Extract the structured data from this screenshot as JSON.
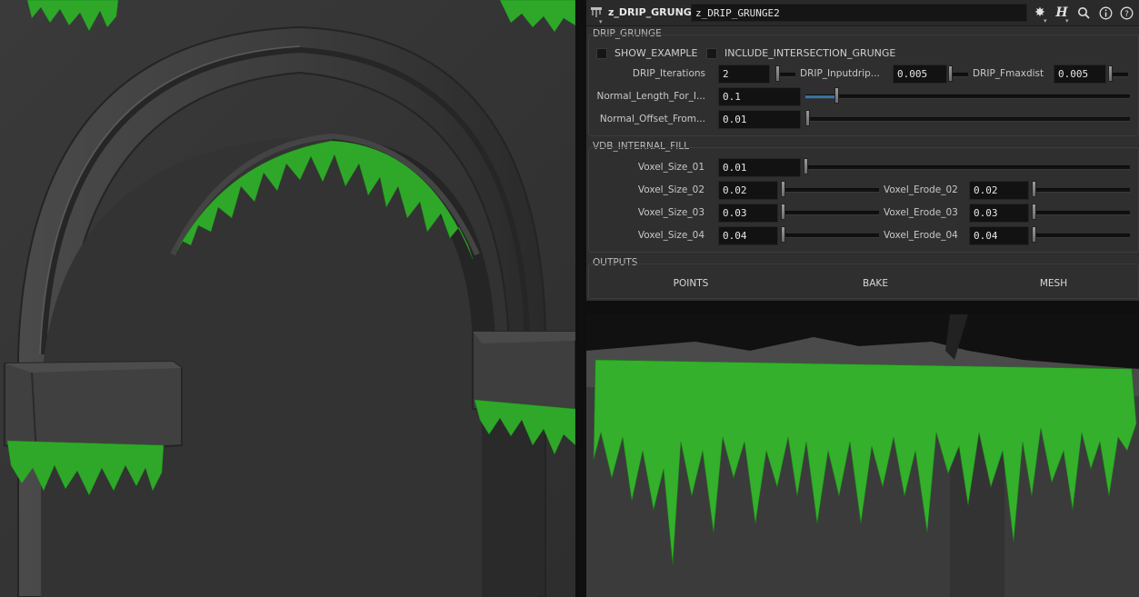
{
  "header": {
    "node_type": "z_DRIP_GRUNGE",
    "node_name": "z_DRIP_GRUNGE2",
    "icons": [
      "gear-icon",
      "houdini-help-icon",
      "search-icon",
      "info-icon",
      "help-icon"
    ]
  },
  "drip_grunge": {
    "folder_label": "DRIP_GRUNGE",
    "show_example_label": "SHOW_EXAMPLE",
    "include_intersection_label": "INCLUDE_INTERSECTION_GRUNGE",
    "drip_iterations_label": "DRIP_Iterations",
    "drip_iterations_value": "2",
    "drip_inputdrip_label": "DRIP_Inputdrip...",
    "drip_inputdrip_value": "0.005",
    "drip_fmaxdist_label": "DRIP_Fmaxdist",
    "drip_fmaxdist_value": "0.005",
    "normal_length_label": "Normal_Length_For_I...",
    "normal_length_value": "0.1",
    "normal_offset_label": "Normal_Offset_From...",
    "normal_offset_value": "0.01"
  },
  "vdb_internal_fill": {
    "folder_label": "VDB_INTERNAL_FILL",
    "voxel_size_01_label": "Voxel_Size_01",
    "voxel_size_01_value": "0.01",
    "voxel_size_02_label": "Voxel_Size_02",
    "voxel_size_02_value": "0.02",
    "voxel_erode_02_label": "Voxel_Erode_02",
    "voxel_erode_02_value": "0.02",
    "voxel_size_03_label": "Voxel_Size_03",
    "voxel_size_03_value": "0.03",
    "voxel_erode_03_label": "Voxel_Erode_03",
    "voxel_erode_03_value": "0.03",
    "voxel_size_04_label": "Voxel_Size_04",
    "voxel_size_04_value": "0.04",
    "voxel_erode_04_label": "Voxel_Erode_04",
    "voxel_erode_04_value": "0.04"
  },
  "outputs": {
    "folder_label": "OUTPUTS",
    "points_label": "POINTS",
    "bake_label": "BAKE",
    "mesh_label": "MESH"
  },
  "colors": {
    "grunge_green": "#2fa82a",
    "stone_gray": "#3a3a3a",
    "slider_blue": "#3d6fa8"
  }
}
